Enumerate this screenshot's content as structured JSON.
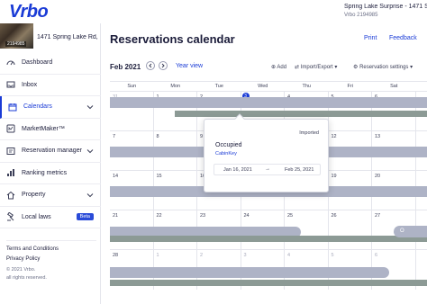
{
  "brand": {
    "logo": "Vrbo"
  },
  "header": {
    "property_name": "Spring Lake Surprise - 1471 Spring Lake Rd",
    "property_id": "Vrbo 2194985"
  },
  "sidebar": {
    "property_card": {
      "thumb_id": "2194985",
      "name": "1471 Spring Lake Rd, Cl"
    },
    "items": [
      {
        "label": "Dashboard",
        "icon": "speedometer-icon"
      },
      {
        "label": "Inbox",
        "icon": "inbox-icon"
      },
      {
        "label": "Calendars",
        "icon": "calendar-icon",
        "active": true
      },
      {
        "label": "MarketMaker™",
        "icon": "marketmaker-icon"
      },
      {
        "label": "Reservation manager",
        "icon": "reservation-icon"
      },
      {
        "label": "Ranking metrics",
        "icon": "ranking-icon"
      },
      {
        "label": "Property",
        "icon": "house-icon"
      },
      {
        "label": "Local laws",
        "icon": "gavel-icon",
        "badge": "Beta"
      }
    ],
    "footer": {
      "terms": "Terms and Conditions",
      "privacy": "Privacy Policy",
      "copyright": "© 2021 Vrbo.",
      "rights": "all rights reserved."
    }
  },
  "main": {
    "title": "Reservations calendar",
    "print_label": "Print",
    "feedback_label": "Feedback",
    "month_label": "Feb 2021",
    "year_view_label": "Year view",
    "add_label": "Add",
    "import_export_label": "Import/Export",
    "settings_label": "Reservation settings",
    "weekdays": [
      "Sun",
      "Mon",
      "Tue",
      "Wed",
      "Thu",
      "Fri",
      "Sat"
    ],
    "weeks": [
      [
        "31",
        "1",
        "2",
        "3",
        "4",
        "5",
        "6"
      ],
      [
        "7",
        "8",
        "9",
        "10",
        "11",
        "12",
        "13"
      ],
      [
        "14",
        "15",
        "16",
        "17",
        "18",
        "19",
        "20"
      ],
      [
        "21",
        "22",
        "23",
        "24",
        "25",
        "26",
        "27"
      ],
      [
        "28",
        "1",
        "2",
        "3",
        "4",
        "5",
        "6"
      ]
    ],
    "today": "3",
    "truncated_label": "O"
  },
  "popover": {
    "tag": "Imported",
    "title": "Occupied",
    "source": "CabinKey",
    "start_date": "Jan 16, 2021",
    "arrow": "→",
    "end_date": "Feb 25, 2021"
  },
  "colors": {
    "accent": "#1a3bd6",
    "booking_bar": "#aeb3c6",
    "booking_bar_dark": "#8c9a95"
  }
}
